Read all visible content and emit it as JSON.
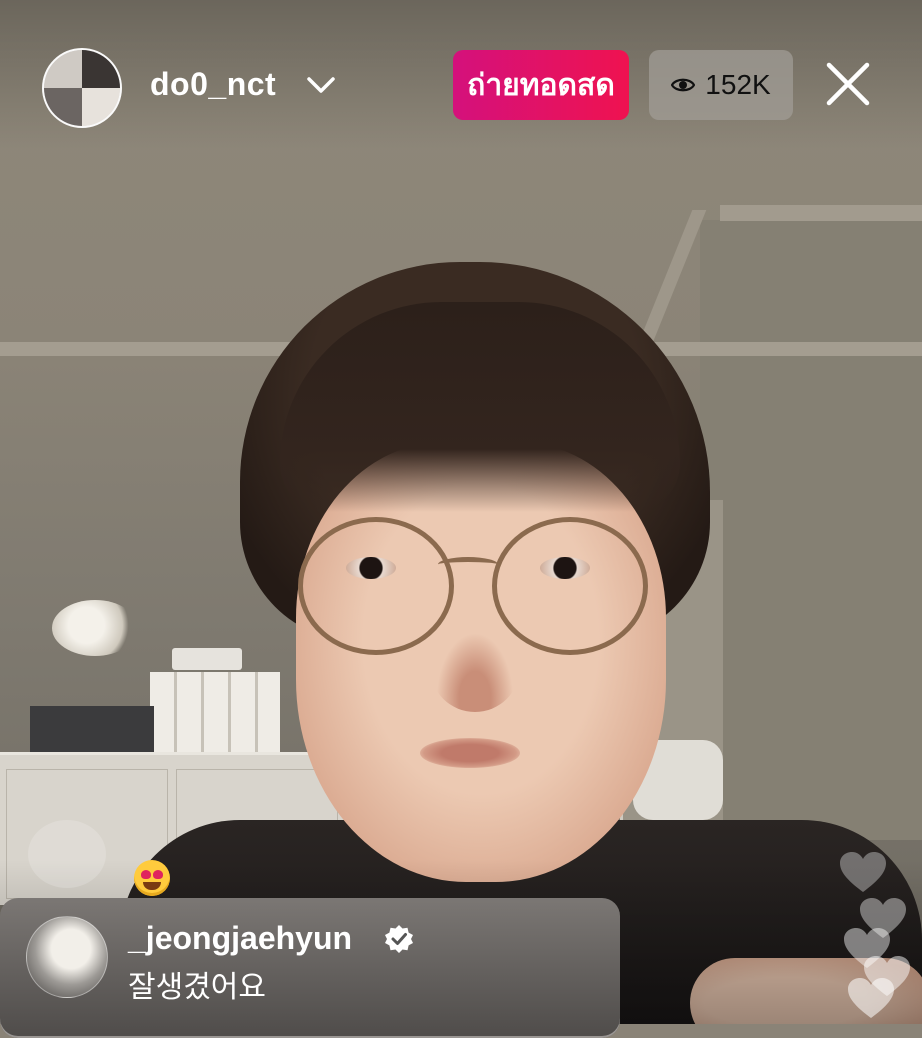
{
  "header": {
    "host_username": "do0_nct",
    "live_label": "ถ่ายทอดสด",
    "viewer_count": "152K"
  },
  "comments": [
    {
      "username": "_jeongjaehyun",
      "verified": true,
      "text": "잘생겼어요"
    }
  ],
  "icons": {
    "dropdown": "chevron-down-icon",
    "viewers": "eye-icon",
    "close": "close-icon",
    "verified": "verified-badge-icon",
    "reaction": "heart-eyes-emoji-icon",
    "likes": "heart-icon"
  },
  "colors": {
    "live_badge_start": "#d4117c",
    "live_badge_end": "#ef1250",
    "viewer_pill": "#a09c96"
  }
}
